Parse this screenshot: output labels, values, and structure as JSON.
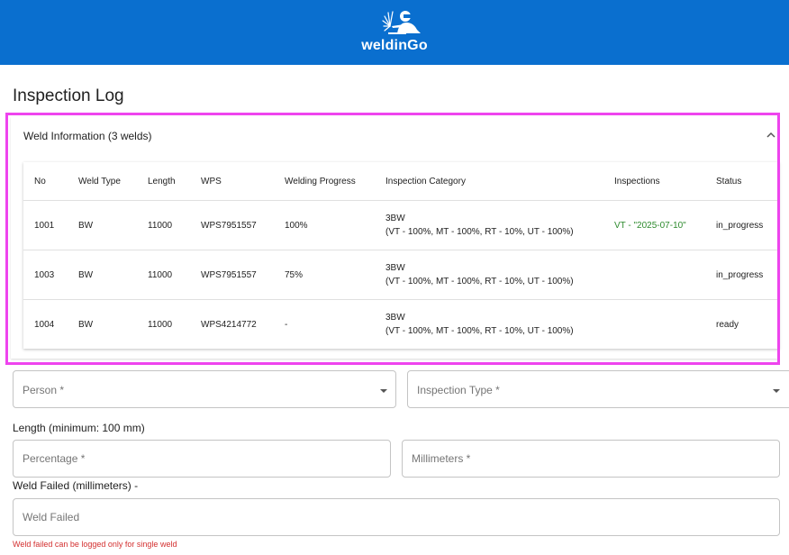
{
  "header": {
    "brand": "weldinGo",
    "logo_icon": "welder-icon",
    "background": "#0a6fcf"
  },
  "page": {
    "title": "Inspection Log"
  },
  "accordion": {
    "title": "Weld Information (3 welds)",
    "chevron_icon": "chevron-up-icon"
  },
  "table": {
    "columns": [
      "No",
      "Weld Type",
      "Length",
      "WPS",
      "Welding Progress",
      "Inspection Category",
      "Inspections",
      "Status"
    ],
    "rows": [
      {
        "no": "1001",
        "weld_type": "BW",
        "length": "11000",
        "wps": "WPS7951557",
        "progress": "100%",
        "category_line1": "3BW",
        "category_line2": "(VT - 100%, MT - 100%, RT - 10%, UT - 100%)",
        "inspections": "VT - \"2025-07-10\"",
        "status": "in_progress"
      },
      {
        "no": "1003",
        "weld_type": "BW",
        "length": "11000",
        "wps": "WPS7951557",
        "progress": "75%",
        "category_line1": "3BW",
        "category_line2": "(VT - 100%, MT - 100%, RT - 10%, UT - 100%)",
        "inspections": "",
        "status": "in_progress"
      },
      {
        "no": "1004",
        "weld_type": "BW",
        "length": "11000",
        "wps": "WPS4214772",
        "progress": "-",
        "category_line1": "3BW",
        "category_line2": "(VT - 100%, MT - 100%, RT - 10%, UT - 100%)",
        "inspections": "",
        "status": "ready"
      }
    ],
    "inspection_color": "#2e8b2e"
  },
  "form": {
    "person_placeholder": "Person *",
    "inspection_type_placeholder": "Inspection Type *",
    "length_label": "Length (minimum: 100 mm)",
    "percentage_placeholder": "Percentage *",
    "millimeters_placeholder": "Millimeters *",
    "weld_failed_label": "Weld Failed (millimeters) -",
    "weld_failed_placeholder": "Weld Failed",
    "weld_failed_error": "Weld failed can be logged only for single weld",
    "error_color": "#d32f2f"
  }
}
